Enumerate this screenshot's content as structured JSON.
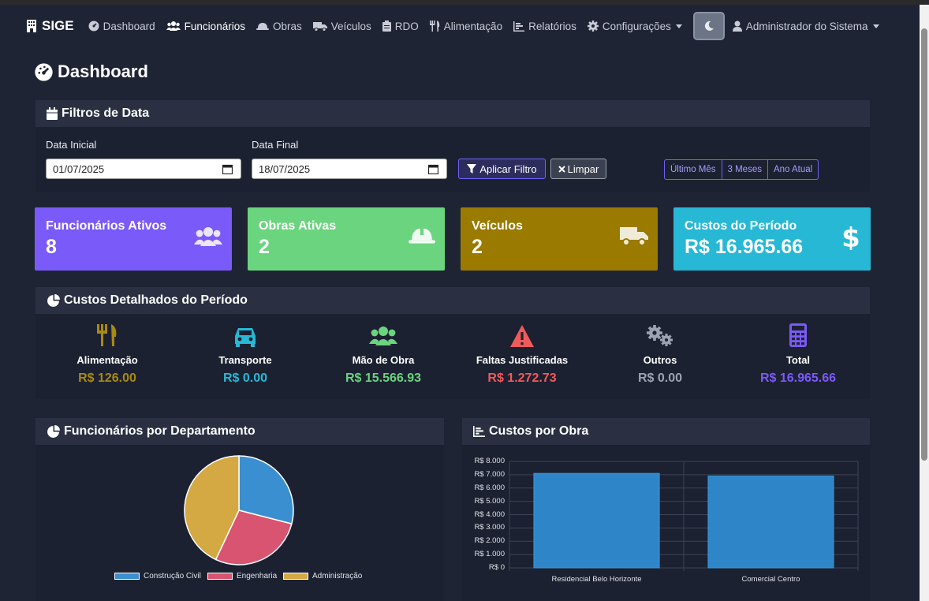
{
  "nav": {
    "brand": "SIGE",
    "items": [
      {
        "label": "Dashboard"
      },
      {
        "label": "Funcionários"
      },
      {
        "label": "Obras"
      },
      {
        "label": "Veículos"
      },
      {
        "label": "RDO"
      },
      {
        "label": "Alimentação"
      },
      {
        "label": "Relatórios"
      },
      {
        "label": "Configurações"
      }
    ],
    "user": "Administrador do Sistema"
  },
  "page": {
    "title": "Dashboard"
  },
  "filters": {
    "title": "Filtros de Data",
    "start_label": "Data Inicial",
    "start_value": "01/07/2025",
    "end_label": "Data Final",
    "end_value": "18/07/2025",
    "apply": "Aplicar Filtro",
    "clear": "Limpar",
    "quick": [
      "Último Mês",
      "3 Meses",
      "Ano Atual"
    ]
  },
  "stats": [
    {
      "label": "Funcionários Ativos",
      "value": "8",
      "color": "#7a5af8",
      "icon": "users-icon"
    },
    {
      "label": "Obras Ativas",
      "value": "2",
      "color": "#6bd47e",
      "icon": "hard-hat-icon"
    },
    {
      "label": "Veículos",
      "value": "2",
      "color": "#9a7b00",
      "icon": "truck-icon"
    },
    {
      "label": "Custos do Período",
      "value": "R$ 16.965.66",
      "color": "#27b8d6",
      "icon": "dollar-icon"
    }
  ],
  "costs": {
    "title": "Custos Detalhados do Período",
    "items": [
      {
        "name": "Alimentação",
        "value": "R$ 126.00",
        "color": "#a88a12",
        "icon": "utensils-icon"
      },
      {
        "name": "Transporte",
        "value": "R$ 0.00",
        "color": "#27b8d6",
        "icon": "car-icon"
      },
      {
        "name": "Mão de Obra",
        "value": "R$ 15.566.93",
        "color": "#6bd47e",
        "icon": "users-icon"
      },
      {
        "name": "Faltas Justificadas",
        "value": "R$ 1.272.73",
        "color": "#f05a5a",
        "icon": "warning-icon"
      },
      {
        "name": "Outros",
        "value": "R$ 0.00",
        "color": "#9ba3b3",
        "icon": "cogs-icon"
      },
      {
        "name": "Total",
        "value": "R$ 16.965.66",
        "color": "#7a5af8",
        "icon": "calculator-icon"
      }
    ]
  },
  "chart_data": [
    {
      "title": "Funcionários por Departamento",
      "type": "pie",
      "labels": [
        "Construção Civil",
        "Engenharia",
        "Administração"
      ],
      "values": [
        29,
        28,
        43
      ],
      "colors": [
        "#3a8fd0",
        "#d95470",
        "#d4a843"
      ]
    },
    {
      "title": "Custos por Obra",
      "type": "bar",
      "categories": [
        "Residencial Belo Horizonte",
        "Comercial Centro"
      ],
      "values": [
        7100,
        6900
      ],
      "ylim": [
        0,
        8000
      ],
      "yticks": [
        "R$ 0",
        "R$ 1.000",
        "R$ 2.000",
        "R$ 3.000",
        "R$ 4.000",
        "R$ 5.000",
        "R$ 6.000",
        "R$ 7.000",
        "R$ 8.000"
      ],
      "color": "#2e86c8"
    }
  ]
}
